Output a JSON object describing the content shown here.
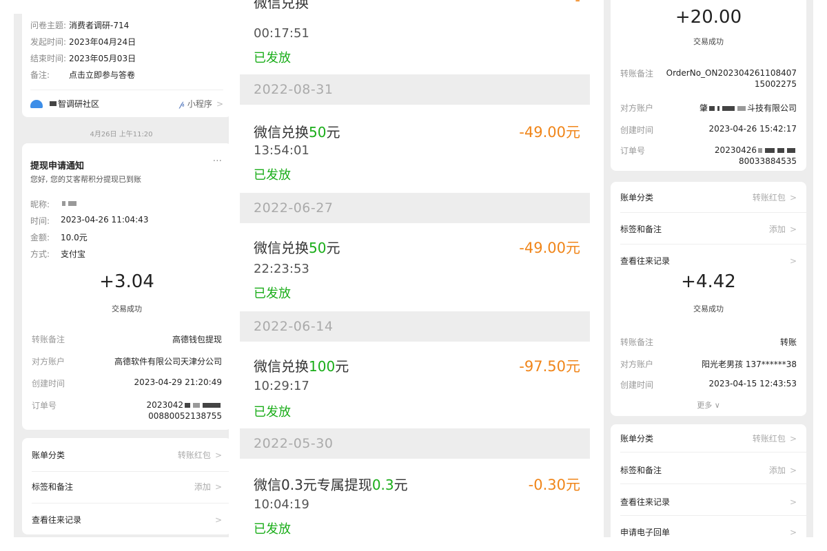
{
  "survey": {
    "rows": [
      {
        "k": "问卷主题:",
        "v": "消费者调研-714"
      },
      {
        "k": "发起时间:",
        "v": "2023年04月24日"
      },
      {
        "k": "结束时间:",
        "v": "2023年05月03日"
      },
      {
        "k": "备注:",
        "v": "点击立即参与答卷"
      }
    ],
    "source": "智调研社区",
    "mini_program": "小程序",
    "timestamp": "4月26日 上午11:20"
  },
  "withdraw": {
    "title": "提现申请通知",
    "more": "···",
    "subtitle": "您好, 您的艾客帮积分提现已到账",
    "rows": [
      {
        "k": "昵称:",
        "v": ""
      },
      {
        "k": "时间:",
        "v": "2023-04-26 11:04:43"
      },
      {
        "k": "金额:",
        "v": "10.0元"
      },
      {
        "k": "方式:",
        "v": "支付宝"
      }
    ]
  },
  "middle": {
    "top_status": "已发放",
    "top_time": "00:17:51",
    "groups": [
      {
        "date": "2022-08-31",
        "title_pre": "微信兑换",
        "title_num": "50",
        "title_post": "元",
        "amount": "-49.00元",
        "time": "13:54:01",
        "status": "已发放"
      },
      {
        "date": "2022-06-27",
        "title_pre": "微信兑换",
        "title_num": "50",
        "title_post": "元",
        "amount": "-49.00元",
        "time": "22:23:53",
        "status": "已发放"
      },
      {
        "date": "2022-06-14",
        "title_pre": "微信兑换",
        "title_num": "100",
        "title_post": "元",
        "amount": "-97.50元",
        "time": "10:29:17",
        "status": "已发放"
      },
      {
        "date": "2022-05-30",
        "title_pre": "微信0.3元专属提现",
        "title_num": "0.3",
        "title_post": "元",
        "amount": "-0.30元",
        "time": "10:04:19",
        "status": "已发放"
      }
    ]
  },
  "receipt_a": {
    "amount": "+20.00",
    "status": "交易成功",
    "note_k": "转账备注",
    "note_v": "OrderNo_ON20230426110840715002275",
    "acct_k": "对方账户",
    "acct_v_pre": "肇",
    "acct_v_post": "斗技有限公司",
    "time_k": "创建时间",
    "time_v": "2023-04-26 15:42:17",
    "order_k": "订单号",
    "order_v_pre": "20230426",
    "order_v_post": "80033884535",
    "menu": [
      {
        "k": "账单分类",
        "v": "转账红包"
      },
      {
        "k": "标签和备注",
        "v": "添加"
      },
      {
        "k": "查看往来记录",
        "v": ""
      }
    ]
  },
  "receipt_b": {
    "amount": "+3.04",
    "status": "交易成功",
    "note_k": "转账备注",
    "note_v": "高德钱包提现",
    "acct_k": "对方账户",
    "acct_v": "高德软件有限公司天津分公司",
    "time_k": "创建时间",
    "time_v": "2023-04-29 21:20:49",
    "order_k": "订单号",
    "order_v_pre": "2023042",
    "order_v_post": "00880052138755",
    "menu": [
      {
        "k": "账单分类",
        "v": "转账红包"
      },
      {
        "k": "标签和备注",
        "v": "添加"
      },
      {
        "k": "查看往来记录",
        "v": ""
      }
    ]
  },
  "receipt_c": {
    "amount": "+4.42",
    "status": "交易成功",
    "note_k": "转账备注",
    "note_v": "转账",
    "acct_k": "对方账户",
    "acct_v": "阳光老男孩 137******38",
    "time_k": "创建时间",
    "time_v": "2023-04-15 12:43:53",
    "more": "更多",
    "menu": [
      {
        "k": "账单分类",
        "v": "转账红包"
      },
      {
        "k": "标签和备注",
        "v": "添加"
      },
      {
        "k": "查看往来记录",
        "v": ""
      },
      {
        "k": "申请电子回单",
        "v": ""
      }
    ]
  },
  "colors": {
    "green": "#1aad19",
    "orange": "#f08519",
    "gray_bg": "#ededed"
  }
}
